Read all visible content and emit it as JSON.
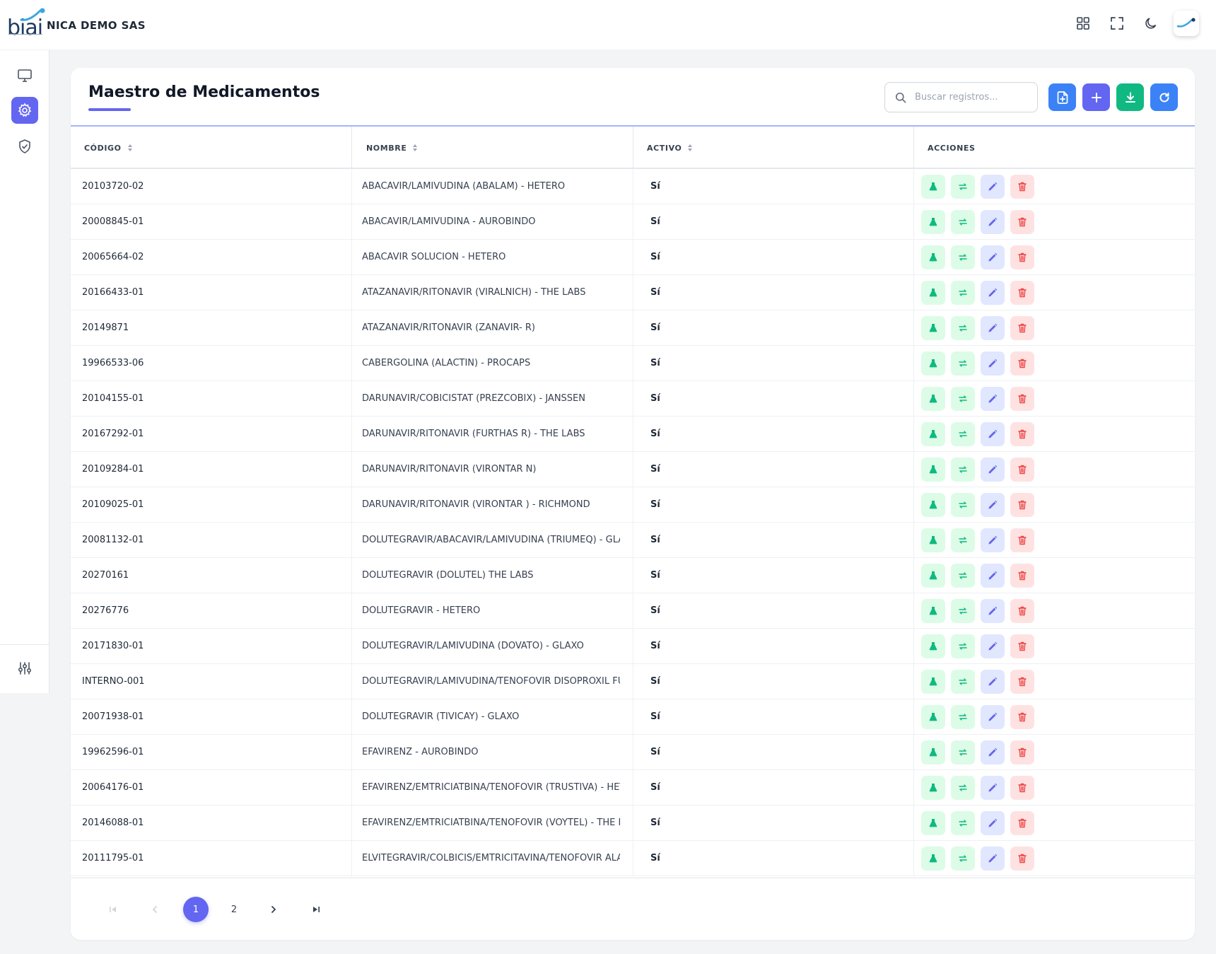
{
  "app": {
    "logo_text": "biai",
    "company": "NICA DEMO SAS"
  },
  "header": {
    "title": "Maestro de Medicamentos",
    "search_placeholder": "Buscar registros..."
  },
  "table": {
    "columns": [
      "CÓDIGO",
      "NOMBRE",
      "ACTIVO",
      "ACCIONES"
    ],
    "rows": [
      {
        "code": "20103720-02",
        "name": "ABACAVIR/LAMIVUDINA (ABALAM) - HETERO",
        "active": "Sí"
      },
      {
        "code": "20008845-01",
        "name": "ABACAVIR/LAMIVUDINA - AUROBINDO",
        "active": "Sí"
      },
      {
        "code": "20065664-02",
        "name": "ABACAVIR SOLUCION - HETERO",
        "active": "Sí"
      },
      {
        "code": "20166433-01",
        "name": "ATAZANAVIR/RITONAVIR (VIRALNICH) - THE LABS",
        "active": "Sí"
      },
      {
        "code": "20149871",
        "name": "ATAZANAVIR/RITONAVIR (ZANAVIR- R)",
        "active": "Sí"
      },
      {
        "code": "19966533-06",
        "name": "CABERGOLINA (ALACTIN) - PROCAPS",
        "active": "Sí"
      },
      {
        "code": "20104155-01",
        "name": "DARUNAVIR/COBICISTAT (PREZCOBIX) - JANSSEN",
        "active": "Sí"
      },
      {
        "code": "20167292-01",
        "name": "DARUNAVIR/RITONAVIR (FURTHAS R) - THE LABS",
        "active": "Sí"
      },
      {
        "code": "20109284-01",
        "name": "DARUNAVIR/RITONAVIR (VIRONTAR N)",
        "active": "Sí"
      },
      {
        "code": "20109025-01",
        "name": "DARUNAVIR/RITONAVIR (VIRONTAR ) - RICHMOND",
        "active": "Sí"
      },
      {
        "code": "20081132-01",
        "name": "DOLUTEGRAVIR/ABACAVIR/LAMIVUDINA (TRIUMEQ) - GLAXO",
        "active": "Sí"
      },
      {
        "code": "20270161",
        "name": "DOLUTEGRAVIR (DOLUTEL) THE LABS",
        "active": "Sí"
      },
      {
        "code": "20276776",
        "name": "DOLUTEGRAVIR - HETERO",
        "active": "Sí"
      },
      {
        "code": "20171830-01",
        "name": "DOLUTEGRAVIR/LAMIVUDINA (DOVATO) - GLAXO",
        "active": "Sí"
      },
      {
        "code": "INTERNO-001",
        "name": "DOLUTEGRAVIR/LAMIVUDINA/TENOFOVIR DISOPROXIL FUM",
        "active": "Sí"
      },
      {
        "code": "20071938-01",
        "name": "DOLUTEGRAVIR (TIVICAY) - GLAXO",
        "active": "Sí"
      },
      {
        "code": "19962596-01",
        "name": "EFAVIRENZ - AUROBINDO",
        "active": "Sí"
      },
      {
        "code": "20064176-01",
        "name": "EFAVIRENZ/EMTRICIATBINA/TENOFOVIR (TRUSTIVA) - HETE",
        "active": "Sí"
      },
      {
        "code": "20146088-01",
        "name": "EFAVIRENZ/EMTRICIATBINA/TENOFOVIR (VOYTEL) - THE LAI",
        "active": "Sí"
      },
      {
        "code": "20111795-01",
        "name": "ELVITEGRAVIR/COLBICIS/EMTRICITAVINA/TENOFOVIR ALAFI",
        "active": "Sí"
      }
    ]
  },
  "pagination": {
    "pages": [
      "1",
      "2"
    ],
    "current": "1"
  },
  "colors": {
    "accent": "#6366f1",
    "primary_blue": "#3b82f6",
    "success": "#10b981",
    "danger": "#ef4444"
  },
  "icons": {
    "topbar": [
      "grid-icon",
      "fullscreen-icon",
      "moon-icon"
    ],
    "sidebar": [
      "monitor-icon",
      "gear-icon",
      "shield-check-icon",
      "sliders-icon"
    ],
    "row_actions": [
      "flask-icon",
      "transfer-icon",
      "edit-icon",
      "trash-icon"
    ],
    "header_actions": [
      "file-import-icon",
      "plus-icon",
      "download-icon",
      "refresh-icon"
    ]
  }
}
